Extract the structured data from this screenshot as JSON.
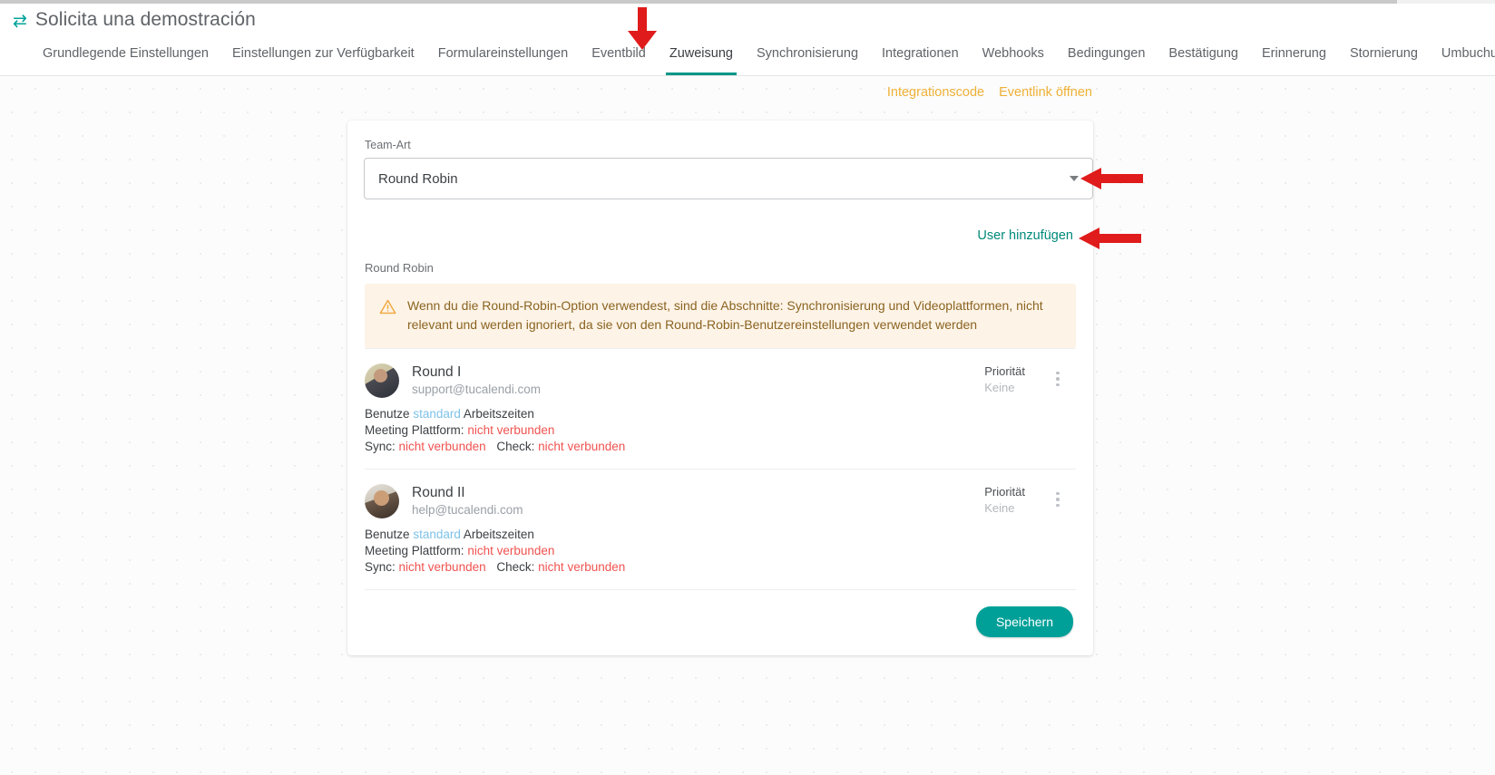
{
  "header": {
    "icon": "swap-horizontal-icon",
    "title": "Solicita una demostración"
  },
  "tabs": [
    {
      "label": "Grundlegende Einstellungen",
      "active": false
    },
    {
      "label": "Einstellungen zur Verfügbarkeit",
      "active": false
    },
    {
      "label": "Formulareinstellungen",
      "active": false
    },
    {
      "label": "Eventbild",
      "active": false
    },
    {
      "label": "Zuweisung",
      "active": true
    },
    {
      "label": "Synchronisierung",
      "active": false
    },
    {
      "label": "Integrationen",
      "active": false
    },
    {
      "label": "Webhooks",
      "active": false
    },
    {
      "label": "Bedingungen",
      "active": false
    },
    {
      "label": "Bestätigung",
      "active": false
    },
    {
      "label": "Erinnerung",
      "active": false
    },
    {
      "label": "Stornierung",
      "active": false
    },
    {
      "label": "Umbuchung",
      "active": false
    }
  ],
  "tabs_next_icon": "chevron-right-icon",
  "toplinks": [
    {
      "label": "Integrationscode"
    },
    {
      "label": "Eventlink öffnen"
    }
  ],
  "form": {
    "team_type_label": "Team-Art",
    "team_type_value": "Round Robin",
    "team_type_options": [
      "Round Robin"
    ],
    "add_user_label": "User hinzufügen",
    "section_label": "Round Robin",
    "alert": {
      "icon": "warning-triangle-icon",
      "text": "Wenn du die Round-Robin-Option verwendest, sind die Abschnitte: Synchronisierung und Videoplattformen, nicht relevant und werden ignoriert, da sie von den Round-Robin-Benutzereinstellungen verwendet werden"
    },
    "save_label": "Speichern"
  },
  "users": [
    {
      "name": "Round I",
      "email": "support@tucalendi.com",
      "hours_prefix": "Benutze",
      "hours_link": "standard",
      "hours_suffix": "Arbeitszeiten",
      "platform_label": "Meeting Plattform:",
      "platform_value": "nicht verbunden",
      "sync_label": "Sync:",
      "sync_value": "nicht verbunden",
      "check_label": "Check:",
      "check_value": "nicht verbunden",
      "priority_label": "Priorität",
      "priority_value": "Keine",
      "menu_icon": "kebab-menu-icon",
      "avatar": "avatar-round-i"
    },
    {
      "name": "Round II",
      "email": "help@tucalendi.com",
      "hours_prefix": "Benutze",
      "hours_link": "standard",
      "hours_suffix": "Arbeitszeiten",
      "platform_label": "Meeting Plattform:",
      "platform_value": "nicht verbunden",
      "sync_label": "Sync:",
      "sync_value": "nicht verbunden",
      "check_label": "Check:",
      "check_value": "nicht verbunden",
      "priority_label": "Priorität",
      "priority_value": "Keine",
      "menu_icon": "kebab-menu-icon",
      "avatar": "avatar-round-ii"
    }
  ],
  "annotations": [
    {
      "name": "arrow-down-to-zuweisung-tab",
      "direction": "down"
    },
    {
      "name": "arrow-to-team-type-dropdown",
      "direction": "left"
    },
    {
      "name": "arrow-to-add-user-link",
      "direction": "left"
    }
  ],
  "colors": {
    "accent_teal": "#009688",
    "link_amber": "#efb036",
    "alert_bg": "#fdf3e6",
    "alert_text": "#8a6422",
    "status_error": "#ef5350",
    "status_link": "#7ec2e8",
    "annotation_red": "#e01b1b",
    "save_button": "#00a098"
  }
}
